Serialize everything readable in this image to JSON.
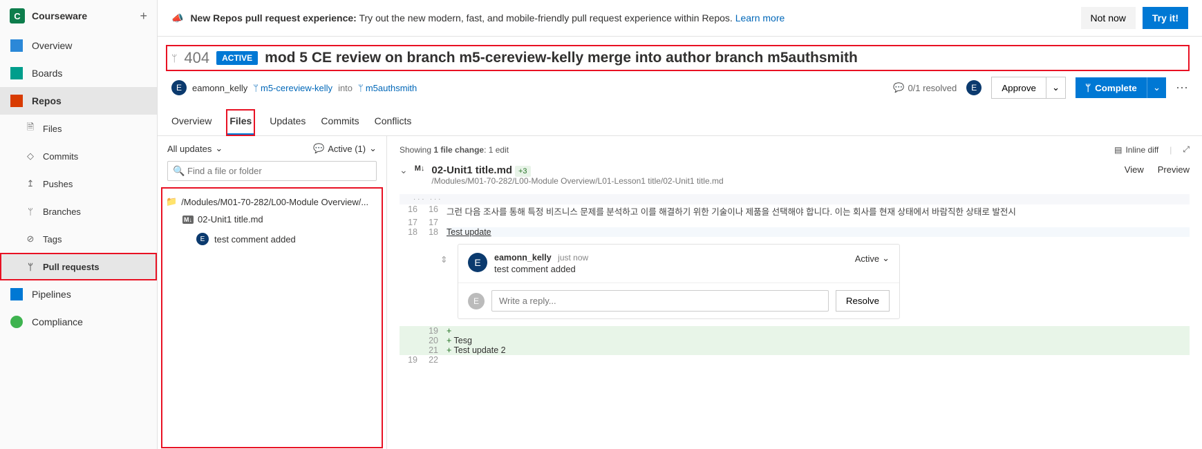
{
  "project": {
    "initial": "C",
    "name": "Courseware"
  },
  "sidebar": {
    "overview": "Overview",
    "boards": "Boards",
    "repos": "Repos",
    "files": "Files",
    "commits": "Commits",
    "pushes": "Pushes",
    "branches": "Branches",
    "tags": "Tags",
    "pullrequests": "Pull requests",
    "pipelines": "Pipelines",
    "compliance": "Compliance"
  },
  "banner": {
    "title": "New Repos pull request experience:",
    "text": " Try out the new modern, fast, and mobile-friendly pull request experience within Repos. ",
    "learn": "Learn more",
    "notnow": "Not now",
    "tryit": "Try it!"
  },
  "pr": {
    "number": "404",
    "status": "ACTIVE",
    "title": "mod 5 CE review on branch m5-cereview-kelly merge into author branch m5authsmith",
    "author": "eamonn_kelly",
    "source": "m5-cereview-kelly",
    "into": "into",
    "target": "m5authsmith",
    "resolved": "0/1 resolved",
    "approve": "Approve",
    "complete": "Complete"
  },
  "tabs": {
    "overview": "Overview",
    "files": "Files",
    "updates": "Updates",
    "commits": "Commits",
    "conflicts": "Conflicts"
  },
  "filters": {
    "all": "All updates",
    "active": "Active (1)"
  },
  "search": {
    "placeholder": "Find a file or folder"
  },
  "tree": {
    "folder": "/Modules/M01-70-282/L00-Module Overview/...",
    "file": "02-Unit1 title.md",
    "comment": "test comment added"
  },
  "diff": {
    "summary_prefix": "Showing ",
    "summary_bold": "1 file change",
    "summary_suffix": ":   1 edit",
    "inline": "Inline diff",
    "filetitle": "02-Unit1 title.md",
    "badge": "+3",
    "filepath": "/Modules/M01-70-282/L00-Module Overview/L01-Lesson1 title/02-Unit1 title.md",
    "view": "View",
    "preview": "Preview"
  },
  "code": {
    "l16": "그런 다음 조사를 통해 특정 비즈니스 문제를 분석하고 이를 해결하기 위한 기술이나 제품을 선택해야 합니다. 이는 회사를 현재 상태에서 바람직한 상태로 발전시",
    "l18": "Test update",
    "a19": "",
    "a20": "Tesg",
    "a21": "Test update 2"
  },
  "thread": {
    "author": "eamonn_kelly",
    "time": "just now",
    "status": "Active",
    "text": "test comment added",
    "reply_placeholder": "Write a reply...",
    "resolve": "Resolve"
  }
}
